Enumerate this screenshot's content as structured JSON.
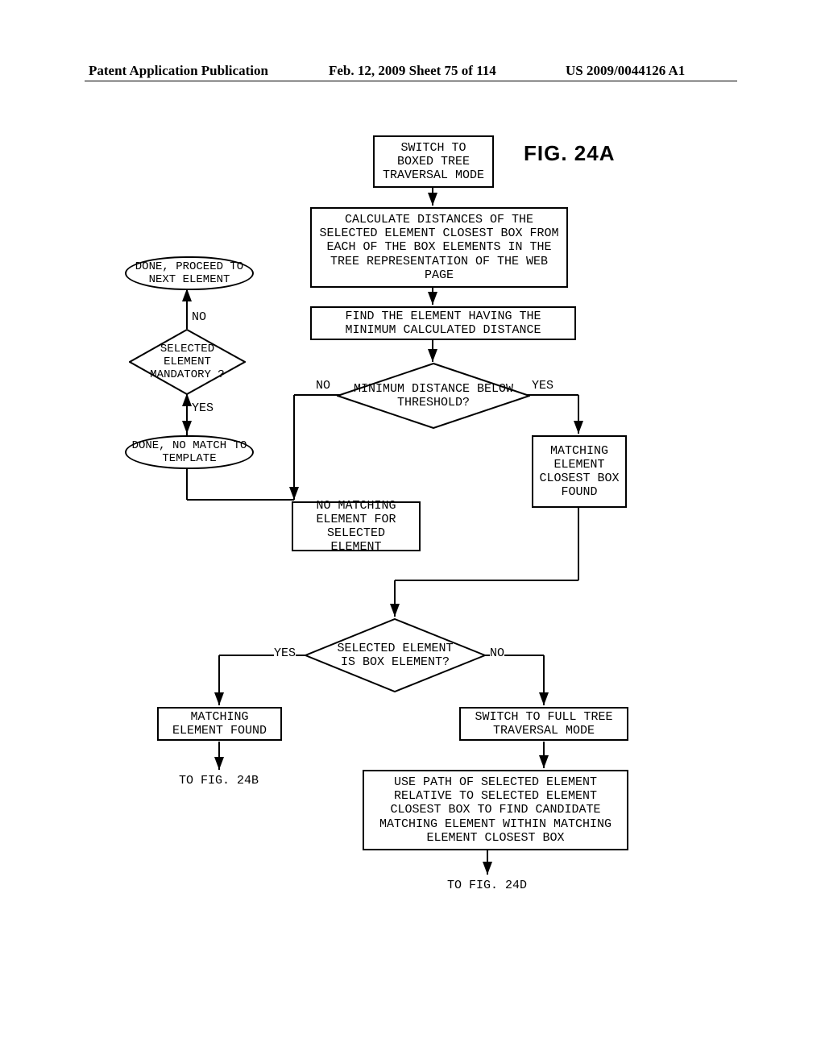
{
  "header": {
    "left": "Patent Application Publication",
    "mid": "Feb. 12, 2009  Sheet 75 of 114",
    "right": "US 2009/0044126 A1"
  },
  "figure_label": "FIG.  24A",
  "nodes": {
    "switch_boxed": "SWITCH TO\nBOXED TREE\nTRAVERSAL MODE",
    "calc_dist": "CALCULATE DISTANCES OF THE SELECTED ELEMENT CLOSEST BOX FROM EACH OF THE BOX ELEMENTS IN THE TREE REPRESENTATION OF THE WEB PAGE",
    "find_min": "FIND THE ELEMENT HAVING THE MINIMUM CALCULATED DISTANCE",
    "min_below": "MINIMUM DISTANCE BELOW THRESHOLD?",
    "closest_found": "MATCHING ELEMENT CLOSEST BOX FOUND",
    "no_match": "NO MATCHING ELEMENT FOR SELECTED ELEMENT",
    "mandatory": "SELECTED ELEMENT MANDATORY ?",
    "done_next": "DONE, PROCEED TO NEXT ELEMENT",
    "done_no_match": "DONE, NO MATCH TO TEMPLATE",
    "is_box": "SELECTED ELEMENT IS BOX ELEMENT?",
    "match_found": "MATCHING ELEMENT FOUND",
    "to_24b": "TO FIG. 24B",
    "switch_full": "SWITCH TO FULL TREE TRAVERSAL MODE",
    "use_path": "USE PATH OF SELECTED ELEMENT RELATIVE TO SELECTED ELEMENT CLOSEST BOX TO FIND CANDIDATE MATCHING ELEMENT WITHIN MATCHING ELEMENT CLOSEST BOX",
    "to_24d": "TO FIG. 24D"
  },
  "edge_labels": {
    "no1": "NO",
    "yes1": "YES",
    "no2": "NO",
    "yes2": "YES",
    "yes3": "YES",
    "no3": "NO"
  }
}
